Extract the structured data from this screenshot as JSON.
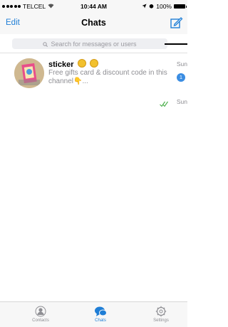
{
  "status_bar": {
    "carrier": "TELCEL",
    "time": "10:44 AM",
    "battery": "100%"
  },
  "nav": {
    "edit_label": "Edit",
    "title": "Chats",
    "compose_icon": "compose-icon"
  },
  "search": {
    "placeholder": "Search for messages or users"
  },
  "chats": [
    {
      "title": "sticker",
      "preview": "Free gifts card & discount code in this channel👇...",
      "date": "Sun",
      "unread": "1"
    },
    {
      "date": "Sun",
      "status_icon": "double-check-icon"
    }
  ],
  "tabs": [
    {
      "label": "Contacts",
      "icon": "contacts-icon"
    },
    {
      "label": "Chats",
      "icon": "chats-icon",
      "active": true
    },
    {
      "label": "Settings",
      "icon": "settings-icon"
    }
  ],
  "colors": {
    "accent": "#1f7ed6",
    "badge": "#3b8de2",
    "read_check": "#4cb04c"
  }
}
